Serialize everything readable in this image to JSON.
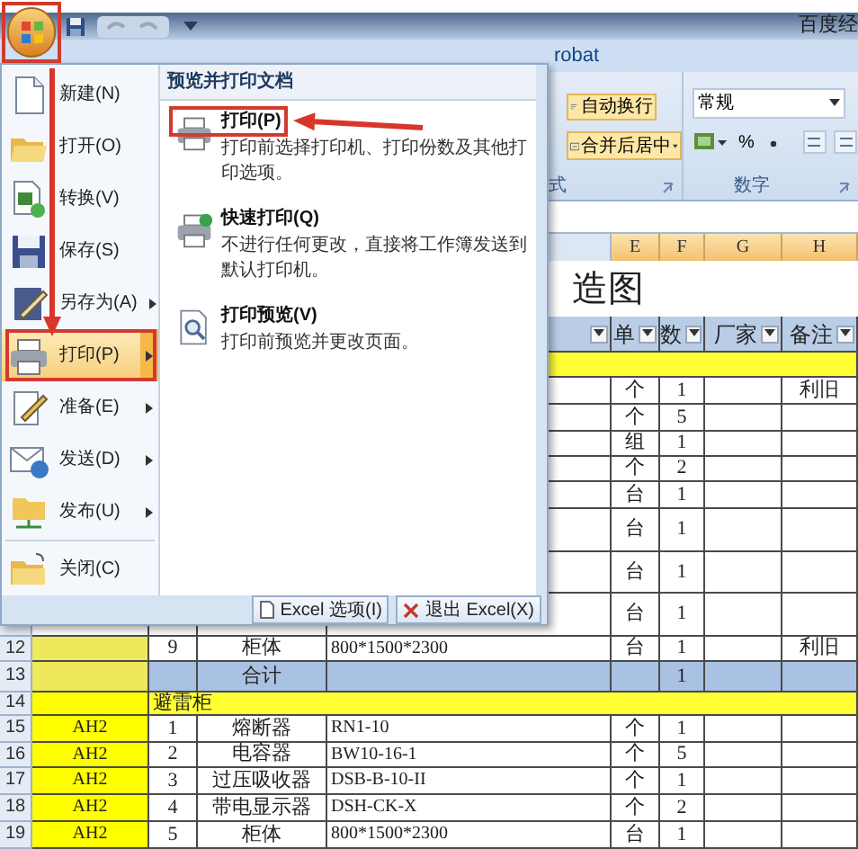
{
  "title_bar": {
    "title": "百度经"
  },
  "office_button": {
    "annotated": true
  },
  "ribbon": {
    "tab": "robat",
    "alignment_group": {
      "label": "式",
      "wrap_button": "自动换行",
      "merge_button": "合并后居中"
    },
    "number_group": {
      "label": "数字",
      "format": "常规",
      "percent_button": "%"
    }
  },
  "office_menu": {
    "items": [
      {
        "label": "新建(N)",
        "submenu": false,
        "selected": false,
        "annotated": false
      },
      {
        "label": "打开(O)",
        "submenu": false,
        "selected": false,
        "annotated": false
      },
      {
        "label": "转换(V)",
        "submenu": false,
        "selected": false,
        "annotated": false
      },
      {
        "label": "保存(S)",
        "submenu": false,
        "selected": false,
        "annotated": false
      },
      {
        "label": "另存为(A)",
        "submenu": true,
        "selected": false,
        "annotated": false
      },
      {
        "label": "打印(P)",
        "submenu": true,
        "selected": true,
        "annotated": true
      },
      {
        "label": "准备(E)",
        "submenu": true,
        "selected": false,
        "annotated": false
      },
      {
        "label": "发送(D)",
        "submenu": true,
        "selected": false,
        "annotated": false
      },
      {
        "label": "发布(U)",
        "submenu": true,
        "selected": false,
        "annotated": false
      },
      {
        "label": "关闭(C)",
        "submenu": false,
        "selected": false,
        "annotated": false,
        "separator_before": true
      }
    ],
    "panel": {
      "title": "预览并打印文档",
      "items": [
        {
          "label": "打印(P)",
          "description": "打印前选择打印机、打印份数及其他打印选项。",
          "annotated": true
        },
        {
          "label": "快速打印(Q)",
          "description": "不进行任何更改，直接将工作簿发送到默认打印机。",
          "annotated": false
        },
        {
          "label": "打印预览(V)",
          "description": "打印前预览并更改页面。",
          "annotated": false
        }
      ]
    },
    "buttons": [
      "Excel 选项(I)",
      "退出 Excel(X)"
    ]
  },
  "sheet": {
    "column_headers": [
      "E",
      "F",
      "G",
      "H"
    ],
    "rows": [
      {
        "kind": "title",
        "cells": {
          "d": "造图"
        }
      },
      {
        "kind": "header",
        "cells": {
          "d": {
            "filter": true
          },
          "e": {
            "text": "单",
            "filter": true
          },
          "f": {
            "text": "数",
            "filter": true
          },
          "g": {
            "text": "厂家",
            "filter": true
          },
          "h": {
            "text": "备注",
            "filter": true
          }
        }
      },
      {
        "kind": "section"
      },
      {
        "kind": "data",
        "cells": {
          "e": "个",
          "f": "1",
          "h": "利旧"
        }
      },
      {
        "kind": "data",
        "cells": {
          "e": "个",
          "f": "5"
        }
      },
      {
        "kind": "data",
        "cells": {
          "e": "组",
          "f": "1"
        }
      },
      {
        "kind": "data",
        "cells": {
          "e": "个",
          "f": "2"
        }
      },
      {
        "kind": "data",
        "cells": {
          "e": "台",
          "f": "1"
        }
      },
      {
        "kind": "data",
        "cells": {
          "e": "台",
          "f": "1"
        }
      },
      {
        "kind": "data",
        "cells": {
          "e": "台",
          "f": "1"
        }
      },
      {
        "kind": "data",
        "cells": {
          "e": "台",
          "f": "1"
        }
      },
      {
        "kind": "data",
        "number": "12",
        "color": "#eee85c",
        "cells": {
          "b": "9",
          "c": "柜体",
          "d": "800*1500*2300",
          "e": "台",
          "f": "1",
          "h": "利旧"
        }
      },
      {
        "kind": "total",
        "number": "13",
        "color": "#eee85c",
        "cells": {
          "c": "合计",
          "f": "1"
        }
      },
      {
        "kind": "section",
        "number": "14",
        "color": "#ffff00",
        "cells": {
          "b": "避雷柜"
        }
      },
      {
        "kind": "data",
        "number": "15",
        "color": "#ffff00",
        "cells": {
          "a": "AH2",
          "b": "1",
          "c": "熔断器",
          "d": "RN1-10",
          "e": "个",
          "f": "1"
        }
      },
      {
        "kind": "data",
        "number": "16",
        "color": "#ffff00",
        "cells": {
          "a": "AH2",
          "b": "2",
          "c": "电容器",
          "d": "BW10-16-1",
          "e": "个",
          "f": "5"
        }
      },
      {
        "kind": "data",
        "number": "17",
        "color": "#ffff00",
        "cells": {
          "a": "AH2",
          "b": "3",
          "c": "过压吸收器",
          "d": "DSB-B-10-II",
          "e": "个",
          "f": "1"
        }
      },
      {
        "kind": "data",
        "number": "18",
        "color": "#ffff00",
        "cells": {
          "a": "AH2",
          "b": "4",
          "c": "带电显示器",
          "d": "DSH-CK-X",
          "e": "个",
          "f": "2"
        }
      },
      {
        "kind": "data",
        "number": "19",
        "color": "#ffff00",
        "cells": {
          "a": "AH2",
          "b": "5",
          "c": "柜体",
          "d": "800*1500*2300",
          "e": "台",
          "f": "1"
        }
      }
    ]
  }
}
